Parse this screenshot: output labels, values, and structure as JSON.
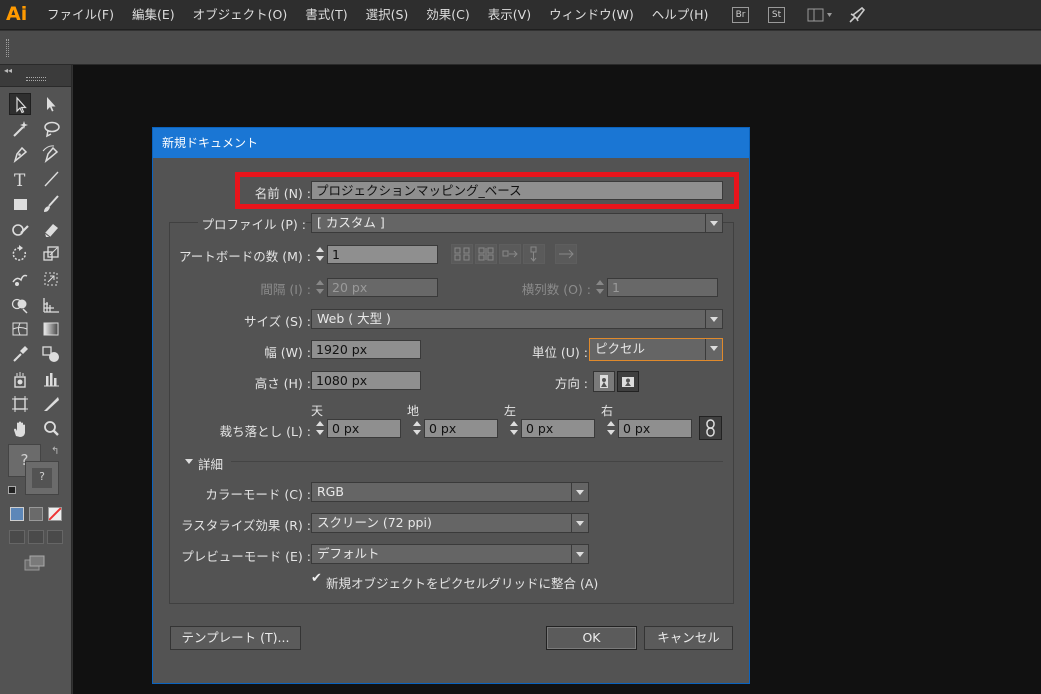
{
  "app": {
    "logo": "Ai"
  },
  "menu": [
    "ファイル(F)",
    "編集(E)",
    "オブジェクト(O)",
    "書式(T)",
    "選択(S)",
    "効果(C)",
    "表示(V)",
    "ウィンドウ(W)",
    "ヘルプ(H)"
  ],
  "menubar_icons": {
    "br": "Br",
    "st": "St"
  },
  "tools": [
    "selection-tool",
    "direct-selection-tool",
    "magic-wand-tool",
    "lasso-tool",
    "pen-tool",
    "curvature-tool",
    "type-tool",
    "line-tool",
    "rectangle-tool",
    "paintbrush-tool",
    "shaper-tool",
    "eraser-tool",
    "rotate-tool",
    "scale-tool",
    "warp-tool",
    "free-transform-tool",
    "shape-builder-tool",
    "perspective-grid-tool",
    "mesh-tool",
    "gradient-tool",
    "eyedropper-tool",
    "blend-tool",
    "symbol-sprayer-tool",
    "column-graph-tool",
    "artboard-tool",
    "slice-tool",
    "hand-tool",
    "zoom-tool"
  ],
  "toolbar_fill_stroke": {
    "fill_label": "?",
    "stroke_label": "?"
  },
  "dialog": {
    "title": "新規ドキュメント",
    "name_label": "名前 (N) :",
    "name_value": "プロジェクションマッピング_ベース",
    "profile_label": "プロファイル (P) :",
    "profile_value": "[ カスタム ]",
    "artboards_label": "アートボードの数 (M) :",
    "artboards_value": "1",
    "spacing_label": "間隔 (I) :",
    "spacing_value": "20 px",
    "columns_label": "横列数 (O) :",
    "columns_value": "1",
    "size_label": "サイズ (S) :",
    "size_value": "Web ( 大型 )",
    "width_label": "幅 (W) :",
    "width_value": "1920 px",
    "units_label": "単位 (U) :",
    "units_value": "ピクセル",
    "height_label": "高さ (H) :",
    "height_value": "1080 px",
    "orientation_label": "方向 :",
    "bleed_label": "裁ち落とし (L) :",
    "bleed": [
      {
        "header": "天",
        "value": "0 px"
      },
      {
        "header": "地",
        "value": "0 px"
      },
      {
        "header": "左",
        "value": "0 px"
      },
      {
        "header": "右",
        "value": "0 px"
      }
    ],
    "advanced_label": "詳細",
    "color_mode_label": "カラーモード (C) :",
    "color_mode_value": "RGB",
    "raster_label": "ラスタライズ効果 (R) :",
    "raster_value": "スクリーン (72 ppi)",
    "preview_label": "プレビューモード (E) :",
    "preview_value": "デフォルト",
    "align_checkbox_label": "新規オブジェクトをピクセルグリッドに整合 (A)",
    "align_checked": true,
    "templates_button": "テンプレート (T)...",
    "ok_button": "OK",
    "cancel_button": "キャンセル"
  },
  "colors": {
    "highlight": "#e8141b",
    "title_bar": "#1a76d4",
    "units_focus": "#e08a2c",
    "logo": "#ff9a00"
  }
}
